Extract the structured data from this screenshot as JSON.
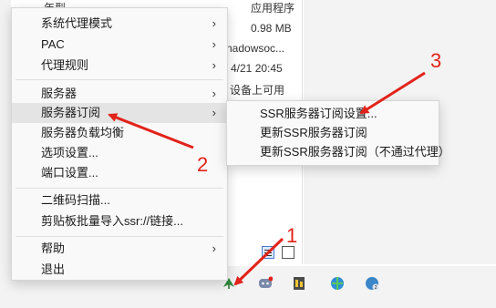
{
  "background": {
    "texts": [
      "年型",
      "应用程序",
      "0.98 MB",
      "nadowsoc...",
      "4/21 20:45",
      "设备上可用"
    ]
  },
  "menu": {
    "items": [
      {
        "label": "系统代理模式",
        "submenu": true
      },
      {
        "label": "PAC",
        "submenu": true
      },
      {
        "label": "代理规则",
        "submenu": true
      },
      {
        "label": "服务器",
        "submenu": true
      },
      {
        "label": "服务器订阅",
        "submenu": true,
        "highlighted": true
      },
      {
        "label": "服务器负载均衡",
        "submenu": false
      },
      {
        "label": "选项设置...",
        "submenu": false
      },
      {
        "label": "端口设置...",
        "submenu": false
      },
      {
        "label": "二维码扫描...",
        "submenu": false
      },
      {
        "label": "剪贴板批量导入ssr://链接...",
        "submenu": false
      },
      {
        "label": "帮助",
        "submenu": true
      },
      {
        "label": "退出",
        "submenu": false
      }
    ],
    "arrow_glyph": "›"
  },
  "submenu": {
    "items": [
      {
        "label": "SSR服务器订阅设置..."
      },
      {
        "label": "更新SSR服务器订阅"
      },
      {
        "label": "更新SSR服务器订阅（不通过代理）"
      }
    ]
  },
  "annotations": {
    "step1": "1",
    "step2": "2",
    "step3": "3",
    "color": "#e2231a"
  },
  "tray": {
    "icons": [
      "shadowsocks-tray-icon",
      "discord-tray-icon",
      "app-tray-icon",
      "network-tray-icon",
      "update-tray-icon"
    ]
  }
}
